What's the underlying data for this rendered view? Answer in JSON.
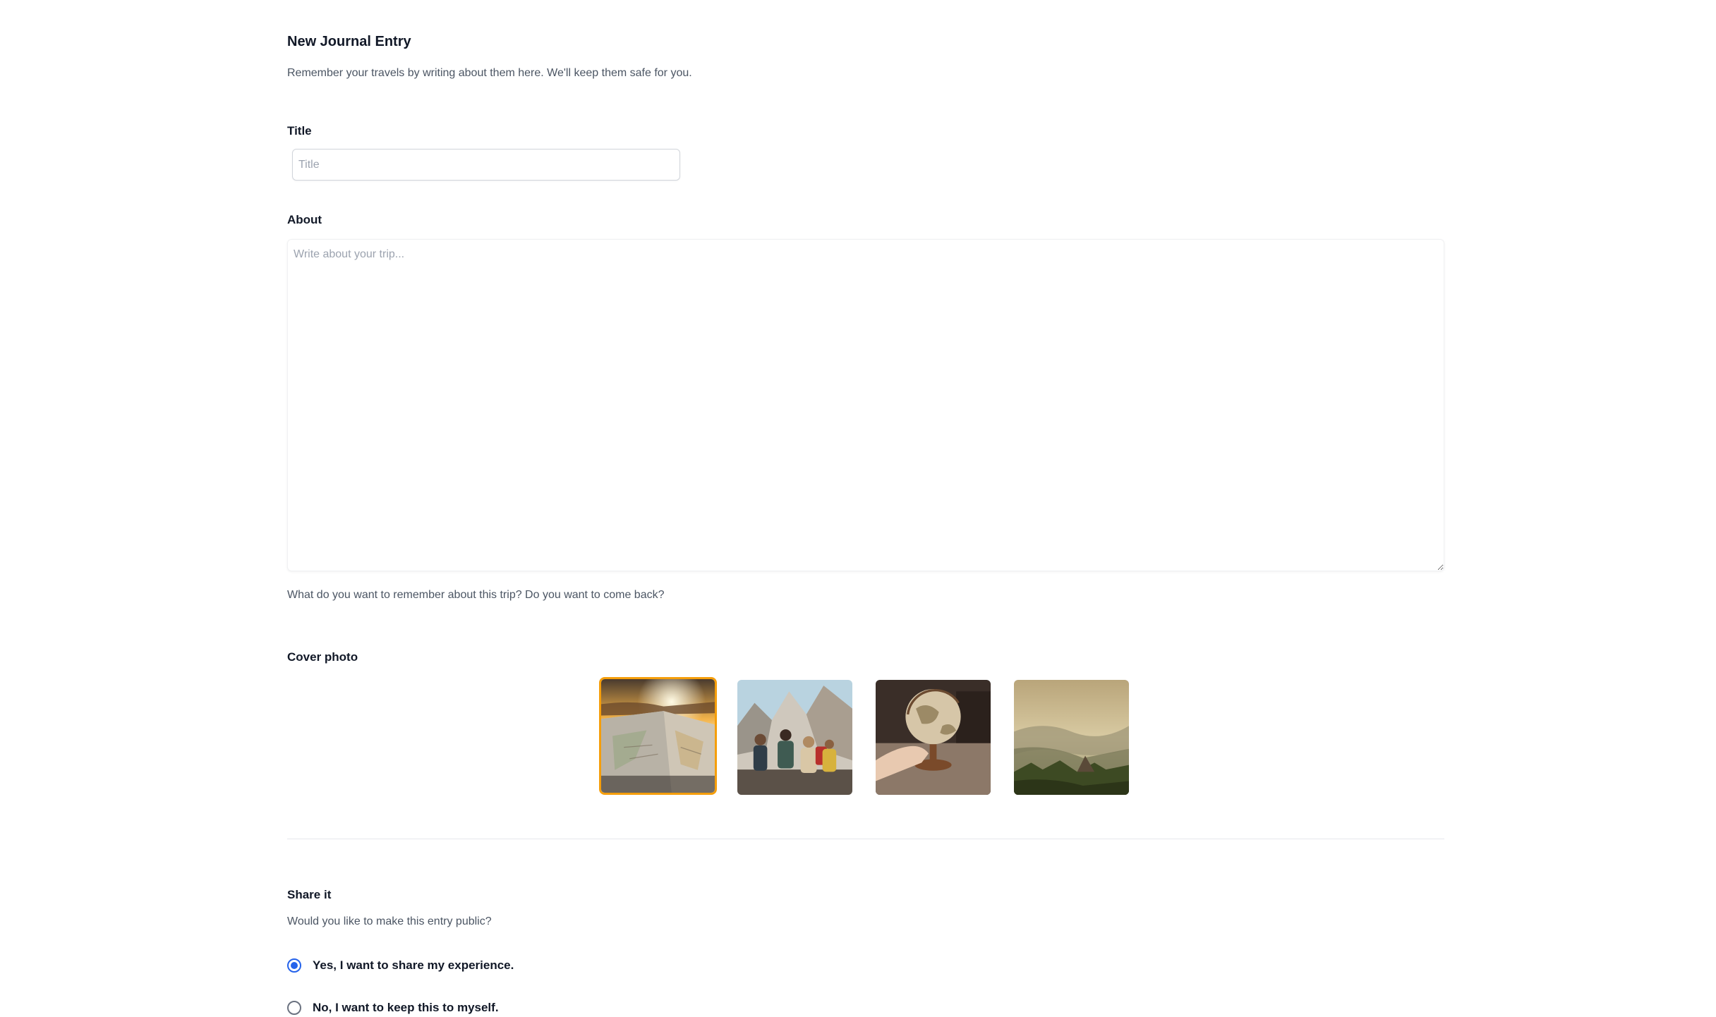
{
  "header": {
    "title": "New Journal Entry",
    "subtitle": "Remember your travels by writing about them here. We'll keep them safe for you."
  },
  "title_field": {
    "label": "Title",
    "placeholder": "Title",
    "value": ""
  },
  "about_field": {
    "label": "About",
    "placeholder": "Write about your trip...",
    "value": "",
    "help_text": "What do you want to remember about this trip? Do you want to come back?"
  },
  "cover_photo": {
    "label": "Cover photo",
    "selected_index": 0,
    "options": [
      {
        "name": "map-sunset-photo"
      },
      {
        "name": "hikers-mountains-photo"
      },
      {
        "name": "hand-globe-photo"
      },
      {
        "name": "mountain-valley-photo"
      }
    ]
  },
  "share": {
    "title": "Share it",
    "subtitle": "Would you like to make this entry public?",
    "options": [
      {
        "label": "Yes, I want to share my experience.",
        "checked": true
      },
      {
        "label": "No, I want to keep this to myself.",
        "checked": false
      }
    ]
  },
  "colors": {
    "selected_border": "#f59e0b",
    "radio_accent": "#2563eb",
    "muted_text": "#4b5563"
  }
}
